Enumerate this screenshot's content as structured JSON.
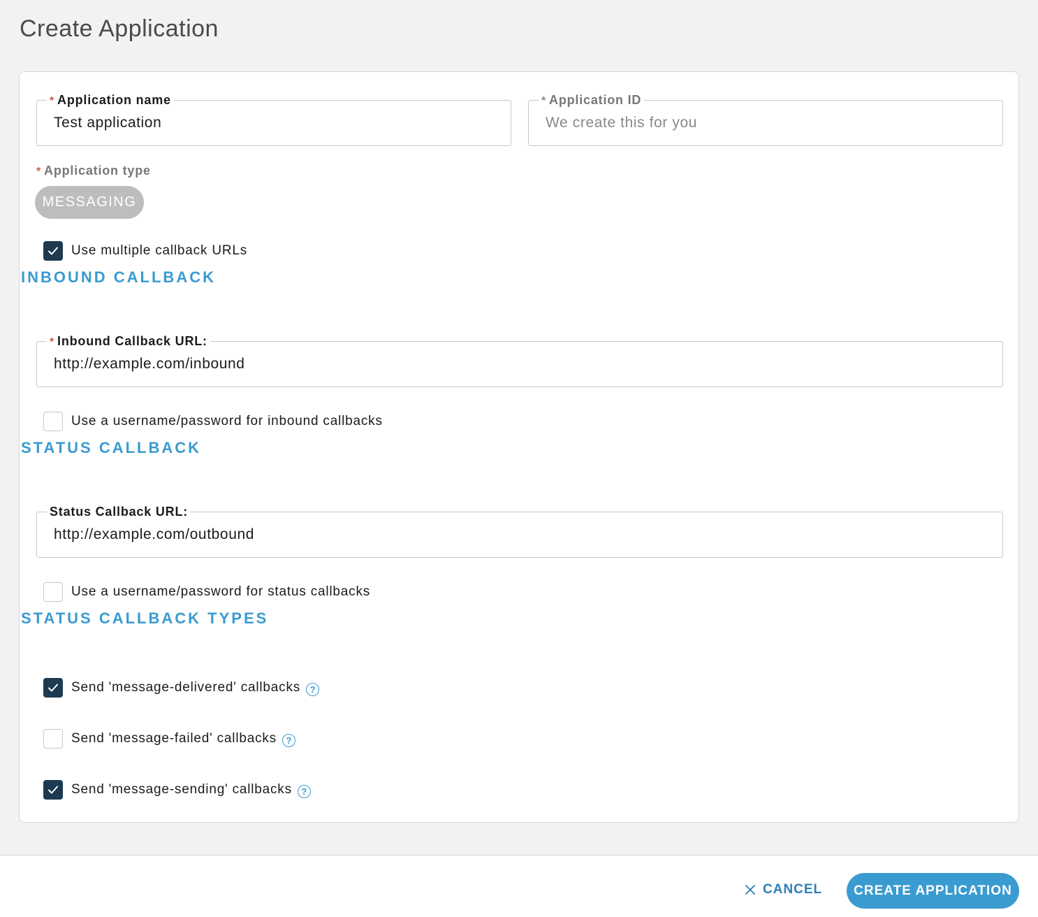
{
  "page": {
    "title": "Create Application"
  },
  "form": {
    "app_name": {
      "required_mark": "*",
      "label": "Application name",
      "value": "Test application"
    },
    "app_id": {
      "required_mark": "*",
      "label": "Application ID",
      "placeholder": "We create this for you"
    },
    "app_type": {
      "required_mark": "*",
      "label": "Application type",
      "selected": "MESSAGING"
    },
    "multiple_callbacks": {
      "label": "Use multiple callback URLs",
      "checked": true
    },
    "inbound": {
      "heading": "INBOUND CALLBACK",
      "url": {
        "required_mark": "*",
        "label": "Inbound Callback URL:",
        "value": "http://example.com/inbound"
      },
      "auth_checkbox": {
        "label": "Use a username/password for inbound callbacks",
        "checked": false
      }
    },
    "status": {
      "heading": "STATUS CALLBACK",
      "url": {
        "label": "Status Callback URL:",
        "value": "http://example.com/outbound"
      },
      "auth_checkbox": {
        "label": "Use a username/password for status callbacks",
        "checked": false
      }
    },
    "status_types": {
      "heading": "STATUS CALLBACK TYPES",
      "items": [
        {
          "label": "Send 'message-delivered' callbacks",
          "checked": true,
          "help": "?"
        },
        {
          "label": "Send 'message-failed' callbacks",
          "checked": false,
          "help": "?"
        },
        {
          "label": "Send 'message-sending' callbacks",
          "checked": true,
          "help": "?"
        }
      ]
    }
  },
  "footer": {
    "cancel_label": "CANCEL",
    "create_label": "CREATE APPLICATION"
  },
  "colors": {
    "accent": "#3a9bd0",
    "checkbox_checked": "#1d3a50",
    "required": "#d9534f"
  }
}
